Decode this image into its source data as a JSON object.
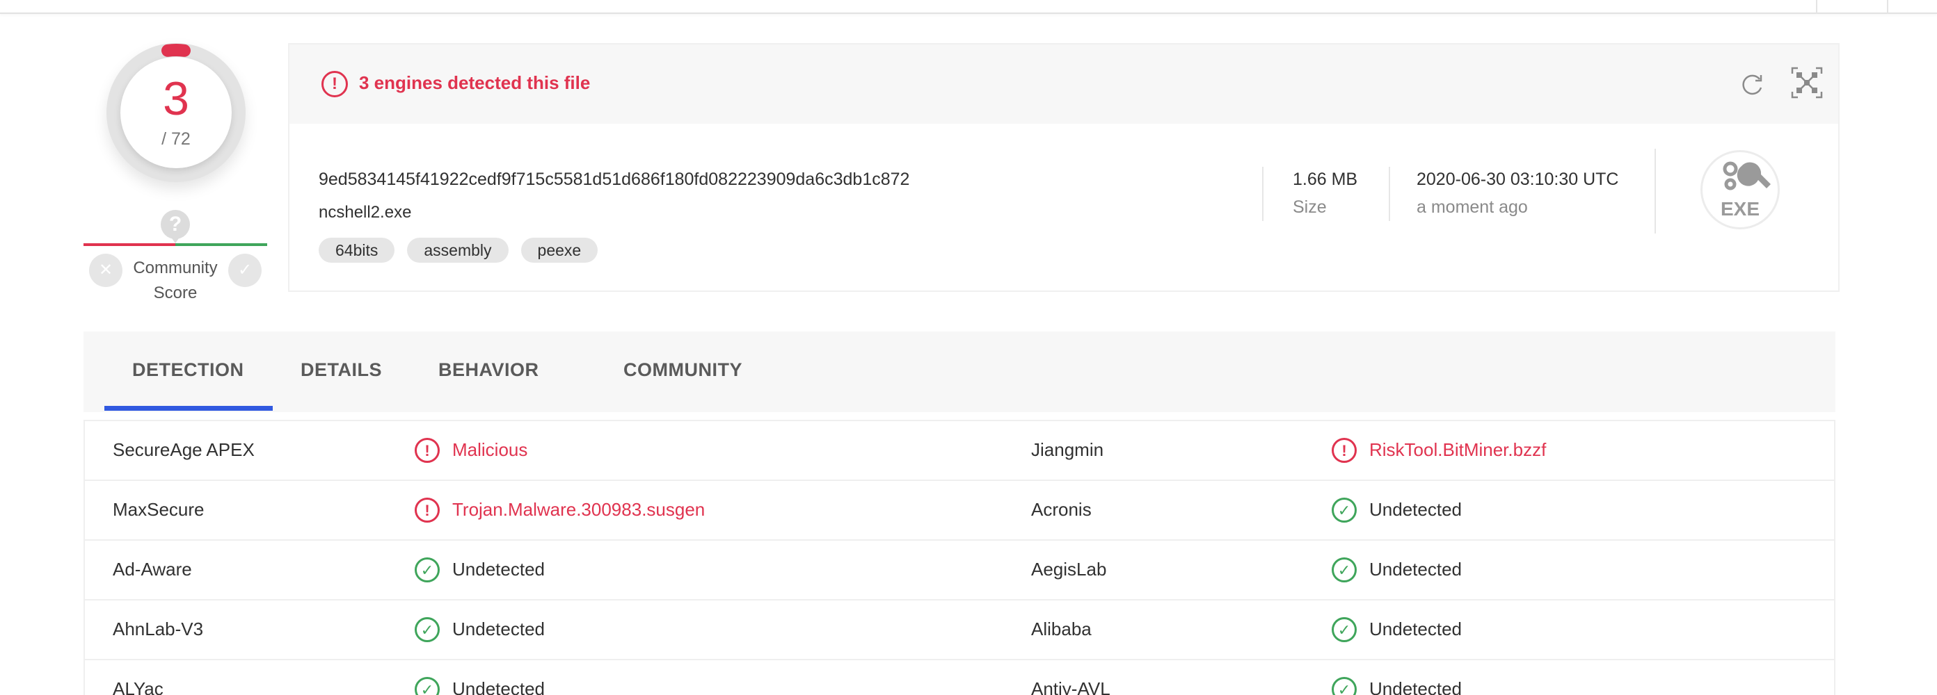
{
  "score": {
    "detections": "3",
    "total": "/ 72",
    "community_label": "Community\nScore",
    "community_marker": "?"
  },
  "alert": {
    "text": "3 engines detected this file"
  },
  "file": {
    "hash": "9ed5834145f41922cedf9f715c5581d51d686f180fd082223909da6c3db1c872",
    "name": "ncshell2.exe",
    "tags": [
      "64bits",
      "assembly",
      "peexe"
    ],
    "size": "1.66 MB",
    "size_label": "Size",
    "date": "2020-06-30 03:10:30 UTC",
    "date_relative": "a moment ago",
    "type_badge": "EXE"
  },
  "tabs": [
    "DETECTION",
    "DETAILS",
    "BEHAVIOR",
    "COMMUNITY"
  ],
  "detections": [
    {
      "left": {
        "engine": "SecureAge APEX",
        "result": "Malicious",
        "status": "malicious"
      },
      "right": {
        "engine": "Jiangmin",
        "result": "RiskTool.BitMiner.bzzf",
        "status": "malicious"
      }
    },
    {
      "left": {
        "engine": "MaxSecure",
        "result": "Trojan.Malware.300983.susgen",
        "status": "malicious"
      },
      "right": {
        "engine": "Acronis",
        "result": "Undetected",
        "status": "undetected"
      }
    },
    {
      "left": {
        "engine": "Ad-Aware",
        "result": "Undetected",
        "status": "undetected"
      },
      "right": {
        "engine": "AegisLab",
        "result": "Undetected",
        "status": "undetected"
      }
    },
    {
      "left": {
        "engine": "AhnLab-V3",
        "result": "Undetected",
        "status": "undetected"
      },
      "right": {
        "engine": "Alibaba",
        "result": "Undetected",
        "status": "undetected"
      }
    },
    {
      "left": {
        "engine": "ALYac",
        "result": "Undetected",
        "status": "undetected"
      },
      "right": {
        "engine": "Antiy-AVL",
        "result": "Undetected",
        "status": "undetected"
      }
    }
  ],
  "colors": {
    "malicious": "#e0334f",
    "undetected": "#3fa55b",
    "accent": "#3159e0"
  }
}
